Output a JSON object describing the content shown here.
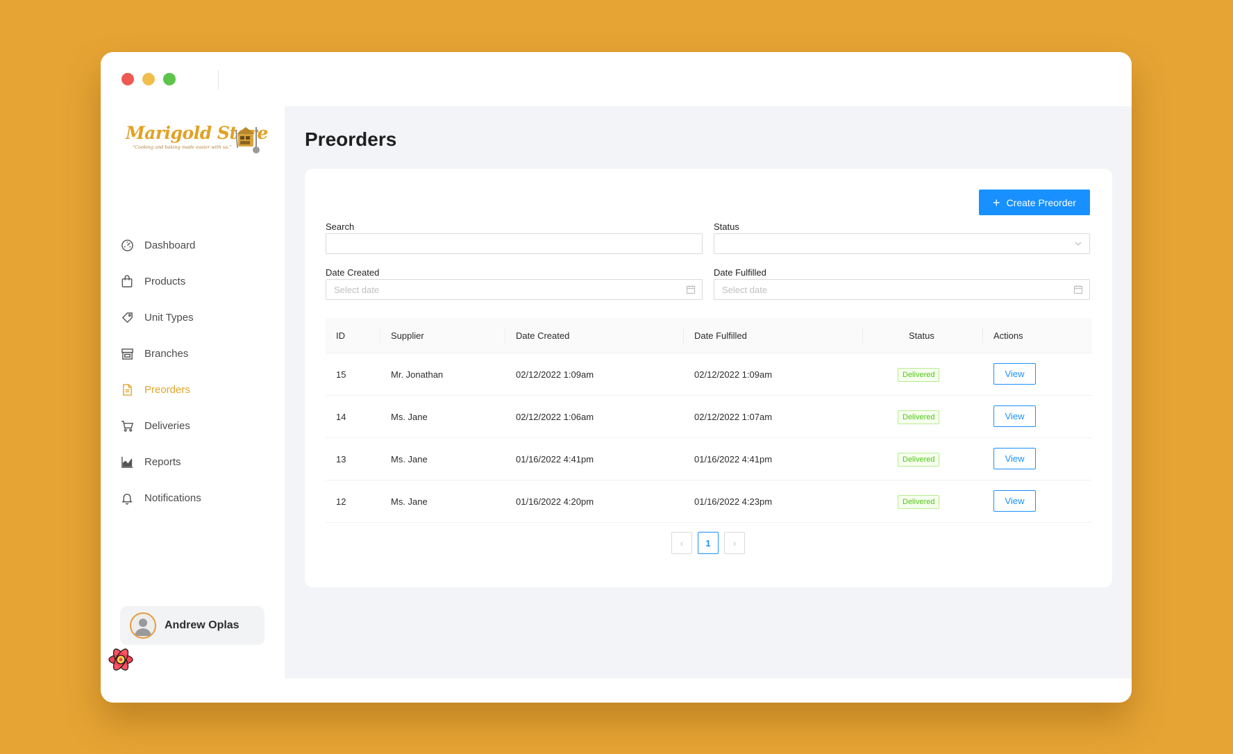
{
  "brand": {
    "name": "Marigold Store",
    "tagline": "\"Cooking and baking made easier with us.\""
  },
  "sidebar": {
    "items": [
      {
        "label": "Dashboard",
        "icon": "dashboard-icon"
      },
      {
        "label": "Products",
        "icon": "shopping-bag-icon"
      },
      {
        "label": "Unit Types",
        "icon": "tag-icon"
      },
      {
        "label": "Branches",
        "icon": "shop-icon"
      },
      {
        "label": "Preorders",
        "icon": "file-text-icon",
        "active": true
      },
      {
        "label": "Deliveries",
        "icon": "shopping-cart-icon"
      },
      {
        "label": "Reports",
        "icon": "area-chart-icon"
      },
      {
        "label": "Notifications",
        "icon": "bell-icon"
      }
    ],
    "user": {
      "name": "Andrew Oplas"
    }
  },
  "main": {
    "title": "Preorders",
    "create_button": "Create Preorder",
    "filters": {
      "search_label": "Search",
      "search_value": "",
      "status_label": "Status",
      "status_value": "",
      "date_created_label": "Date Created",
      "date_created_placeholder": "Select date",
      "date_fulfilled_label": "Date Fulfilled",
      "date_fulfilled_placeholder": "Select date"
    },
    "table": {
      "columns": [
        "ID",
        "Supplier",
        "Date Created",
        "Date Fulfilled",
        "Status",
        "Actions"
      ],
      "rows": [
        {
          "id": "15",
          "supplier": "Mr. Jonathan",
          "date_created": "02/12/2022 1:09am",
          "date_fulfilled": "02/12/2022 1:09am",
          "status": "Delivered",
          "action": "View"
        },
        {
          "id": "14",
          "supplier": "Ms. Jane",
          "date_created": "02/12/2022 1:06am",
          "date_fulfilled": "02/12/2022 1:07am",
          "status": "Delivered",
          "action": "View"
        },
        {
          "id": "13",
          "supplier": "Ms. Jane",
          "date_created": "01/16/2022 4:41pm",
          "date_fulfilled": "01/16/2022 4:41pm",
          "status": "Delivered",
          "action": "View"
        },
        {
          "id": "12",
          "supplier": "Ms. Jane",
          "date_created": "01/16/2022 4:20pm",
          "date_fulfilled": "01/16/2022 4:23pm",
          "status": "Delivered",
          "action": "View"
        }
      ]
    },
    "pagination": {
      "current_page": "1",
      "prev": "‹",
      "next": "›"
    }
  },
  "colors": {
    "background": "#E6A434",
    "accent": "#1890FF",
    "active_nav": "#E2A42C",
    "status_green": "#52C41A"
  }
}
